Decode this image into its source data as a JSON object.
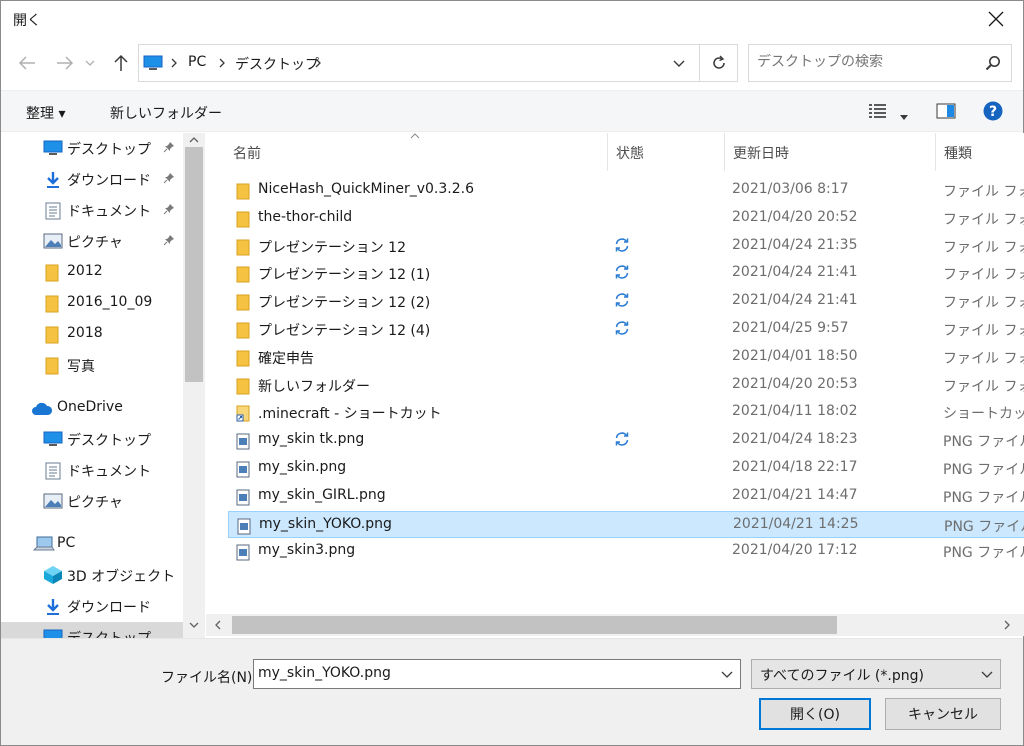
{
  "window": {
    "title": "開く"
  },
  "address": {
    "crumbs": [
      "PC",
      "デスクトップ"
    ]
  },
  "search": {
    "placeholder": "デスクトップの検索"
  },
  "toolbar": {
    "organize": "整理 ▾",
    "new_folder": "新しいフォルダー"
  },
  "nav": {
    "items": [
      {
        "label": "デスクトップ"
      },
      {
        "label": "ダウンロード"
      },
      {
        "label": "ドキュメント"
      },
      {
        "label": "ピクチャ"
      },
      {
        "label": "2012"
      },
      {
        "label": "2016_10_09"
      },
      {
        "label": "2018"
      },
      {
        "label": "写真"
      },
      {
        "label": "OneDrive"
      },
      {
        "label": "デスクトップ"
      },
      {
        "label": "ドキュメント"
      },
      {
        "label": "ピクチャ"
      },
      {
        "label": "PC"
      },
      {
        "label": "3D オブジェクト"
      },
      {
        "label": "ダウンロード"
      },
      {
        "label": "デスクトップ"
      }
    ]
  },
  "columns": {
    "name": "名前",
    "status": "状態",
    "date": "更新日時",
    "type": "種類"
  },
  "files": [
    {
      "name": "NiceHash_QuickMiner_v0.3.2.6",
      "date": "2021/03/06 8:17",
      "type": "ファイル フォルダー",
      "kind": "folder",
      "sync": false
    },
    {
      "name": "the-thor-child",
      "date": "2021/04/20 20:52",
      "type": "ファイル フォルダー",
      "kind": "folder",
      "sync": false
    },
    {
      "name": "プレゼンテーション 12",
      "date": "2021/04/24 21:35",
      "type": "ファイル フォルダー",
      "kind": "folder",
      "sync": true
    },
    {
      "name": "プレゼンテーション 12 (1)",
      "date": "2021/04/24 21:41",
      "type": "ファイル フォルダー",
      "kind": "folder",
      "sync": true
    },
    {
      "name": "プレゼンテーション 12 (2)",
      "date": "2021/04/24 21:41",
      "type": "ファイル フォルダー",
      "kind": "folder",
      "sync": true
    },
    {
      "name": "プレゼンテーション 12 (4)",
      "date": "2021/04/25 9:57",
      "type": "ファイル フォルダー",
      "kind": "folder",
      "sync": true
    },
    {
      "name": "確定申告",
      "date": "2021/04/01 18:50",
      "type": "ファイル フォルダー",
      "kind": "folder",
      "sync": false
    },
    {
      "name": "新しいフォルダー",
      "date": "2021/04/20 20:53",
      "type": "ファイル フォルダー",
      "kind": "folder",
      "sync": false
    },
    {
      "name": ".minecraft - ショートカット",
      "date": "2021/04/11 18:02",
      "type": "ショートカット",
      "kind": "shortcut",
      "sync": false
    },
    {
      "name": "my_skin tk.png",
      "date": "2021/04/24 18:23",
      "type": "PNG ファイル",
      "kind": "png",
      "sync": true
    },
    {
      "name": "my_skin.png",
      "date": "2021/04/18 22:17",
      "type": "PNG ファイル",
      "kind": "png",
      "sync": false
    },
    {
      "name": "my_skin_GIRL.png",
      "date": "2021/04/21 14:47",
      "type": "PNG ファイル",
      "kind": "png",
      "sync": false
    },
    {
      "name": "my_skin_YOKO.png",
      "date": "2021/04/21 14:25",
      "type": "PNG ファイル",
      "kind": "png",
      "sync": false
    },
    {
      "name": "my_skin3.png",
      "date": "2021/04/20 17:12",
      "type": "PNG ファイル",
      "kind": "png",
      "sync": false
    }
  ],
  "bottom": {
    "filename_label": "ファイル名(N):",
    "filename_value": "my_skin_YOKO.png",
    "filter_value": "すべてのファイル (*.png)",
    "open_label": "開く(O)",
    "cancel_label": "キャンセル"
  },
  "colors": {
    "accent": "#0078d7",
    "folder": "#f5c242",
    "selection": "#cce8ff",
    "sync": "#2b7cd3"
  }
}
